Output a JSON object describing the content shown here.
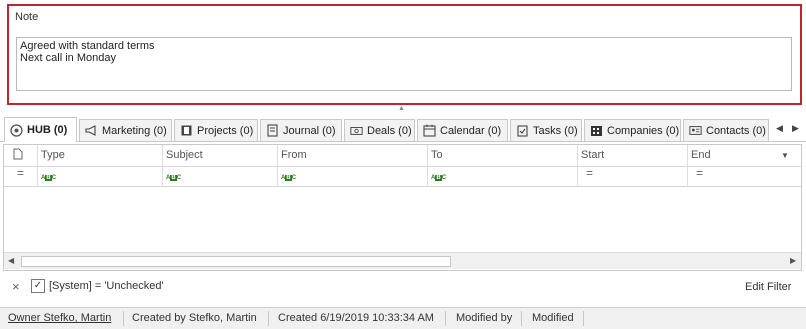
{
  "note": {
    "label": "Note",
    "lines": [
      "Agreed with standard terms",
      "Next call in Monday"
    ]
  },
  "tabs": [
    {
      "label": "HUB (0)",
      "icon": "hub-icon",
      "active": true
    },
    {
      "label": "Marketing (0)",
      "icon": "megaphone-icon"
    },
    {
      "label": "Projects (0)",
      "icon": "projects-icon"
    },
    {
      "label": "Journal (0)",
      "icon": "journal-icon"
    },
    {
      "label": "Deals (0)",
      "icon": "deals-icon"
    },
    {
      "label": "Calendar (0)",
      "icon": "calendar-icon"
    },
    {
      "label": "Tasks (0)",
      "icon": "tasks-icon"
    },
    {
      "label": "Companies (0)",
      "icon": "companies-icon"
    },
    {
      "label": "Contacts (0)",
      "icon": "contacts-icon"
    }
  ],
  "grid": {
    "columns": [
      "Type",
      "Subject",
      "From",
      "To",
      "Start",
      "End"
    ],
    "filter_abc": "ABC",
    "filter_eq": "="
  },
  "filter": {
    "close": "×",
    "checkbox": "✓",
    "expression": "[System] = 'Unchecked'",
    "edit_label": "Edit Filter"
  },
  "status": {
    "owner": "Owner Stefko, Martin",
    "created_by": "Created by Stefko, Martin",
    "created": "Created 6/19/2019 10:33:34 AM",
    "modified_by": "Modified by",
    "modified": "Modified"
  }
}
